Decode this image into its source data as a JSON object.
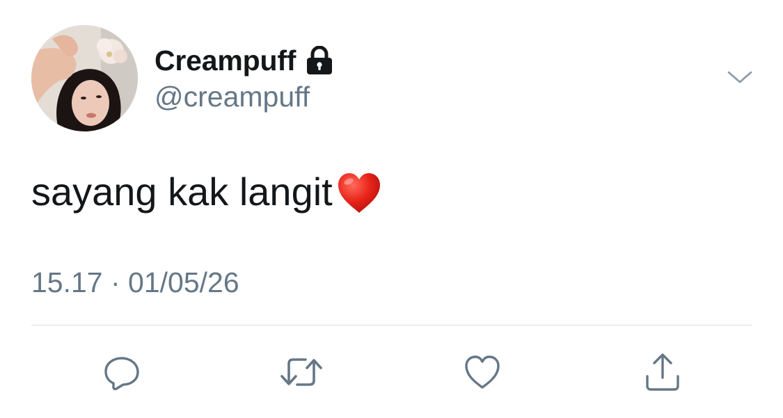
{
  "tweet": {
    "display_name": "Creampuff",
    "handle": "@creampuff",
    "text": "sayang kak langit",
    "emoji": "❤️",
    "timestamp": "15.17 · 01/05/26",
    "protected_icon": "lock-icon",
    "menu_icon": "chevron-down-icon"
  },
  "actions": [
    {
      "name": "reply",
      "icon": "reply-bubble-icon"
    },
    {
      "name": "retweet",
      "icon": "retweet-icon"
    },
    {
      "name": "like",
      "icon": "heart-outline-icon"
    },
    {
      "name": "share",
      "icon": "share-icon"
    }
  ],
  "colors": {
    "text_primary": "#14171a",
    "text_secondary": "#657786",
    "icon_gray": "#657786",
    "divider": "#d8dee3",
    "heart_red": "#e0251b"
  }
}
